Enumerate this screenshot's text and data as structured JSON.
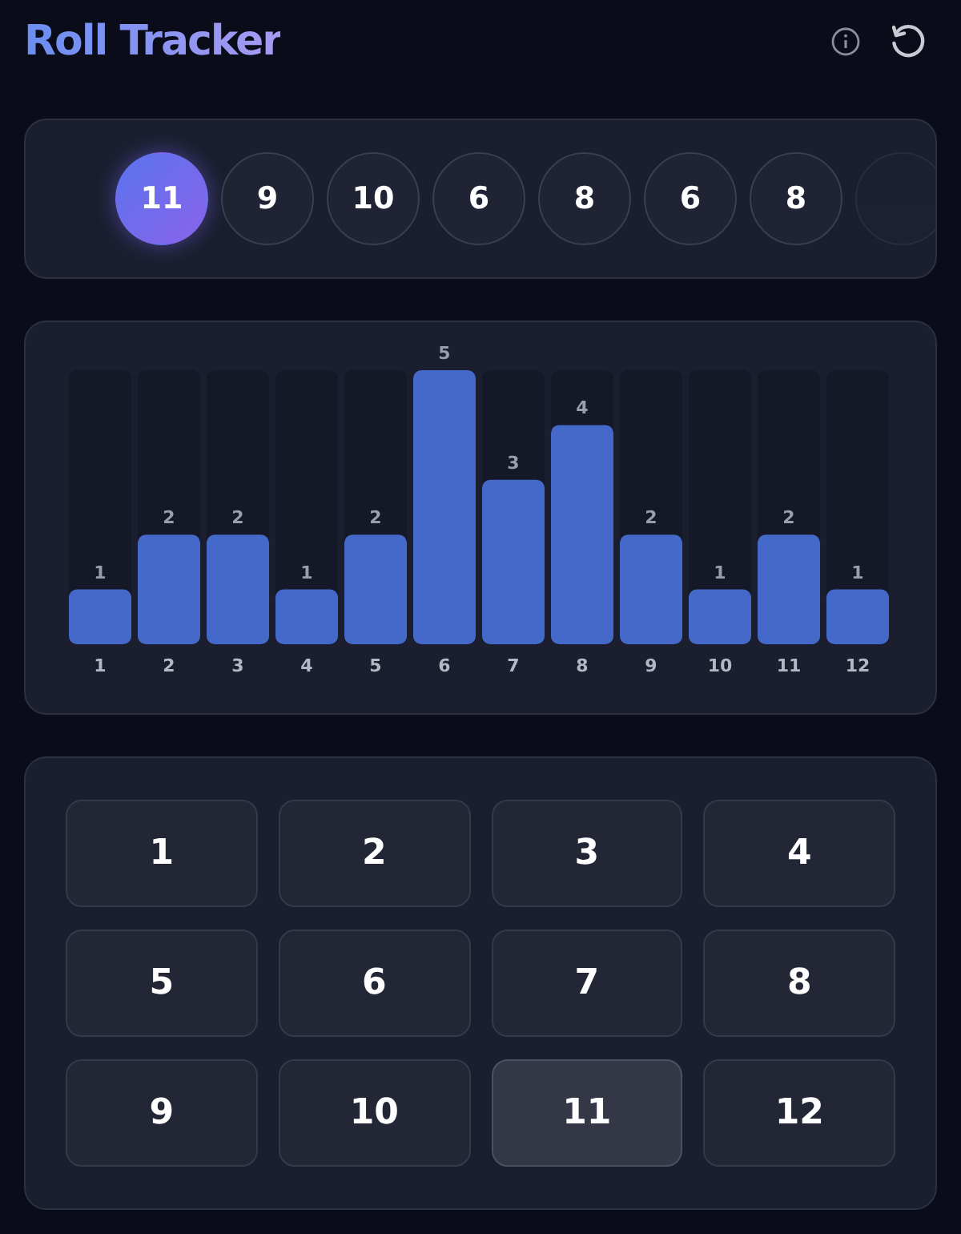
{
  "header": {
    "title": "Roll Tracker"
  },
  "history": {
    "rolls": [
      {
        "value": "11",
        "latest": true
      },
      {
        "value": "9",
        "latest": false
      },
      {
        "value": "10",
        "latest": false
      },
      {
        "value": "6",
        "latest": false
      },
      {
        "value": "8",
        "latest": false
      },
      {
        "value": "6",
        "latest": false
      },
      {
        "value": "8",
        "latest": false
      }
    ],
    "more": true
  },
  "distribution": {
    "chart_data": {
      "type": "bar",
      "categories": [
        "1",
        "2",
        "3",
        "4",
        "5",
        "6",
        "7",
        "8",
        "9",
        "10",
        "11",
        "12"
      ],
      "values": [
        1,
        2,
        2,
        1,
        2,
        5,
        3,
        4,
        2,
        1,
        2,
        1
      ],
      "data_labels": true
    }
  },
  "keypad": [
    {
      "label": "1",
      "selected": false
    },
    {
      "label": "2",
      "selected": false
    },
    {
      "label": "3",
      "selected": false
    },
    {
      "label": "4",
      "selected": false
    },
    {
      "label": "5",
      "selected": false
    },
    {
      "label": "6",
      "selected": false
    },
    {
      "label": "7",
      "selected": false
    },
    {
      "label": "8",
      "selected": false
    },
    {
      "label": "9",
      "selected": false
    },
    {
      "label": "10",
      "selected": false
    },
    {
      "label": "11",
      "selected": true
    },
    {
      "label": "12",
      "selected": false
    }
  ]
}
